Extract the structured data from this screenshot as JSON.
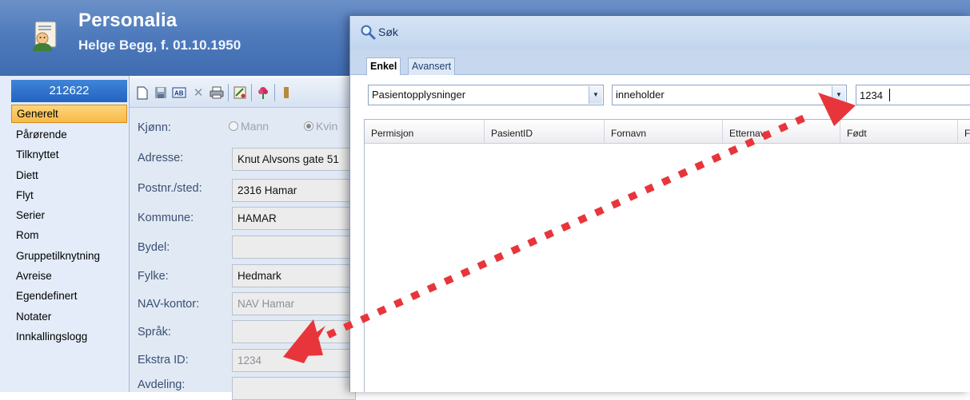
{
  "app": {
    "title": "Personalia",
    "patient_line": "Helge Begg, f. 01.10.1950",
    "patient_id": "212622",
    "nav_items": [
      {
        "label": "Generelt",
        "selected": true
      },
      {
        "label": "Pårørende"
      },
      {
        "label": "Tilknyttet"
      },
      {
        "label": "Diett"
      },
      {
        "label": "Flyt"
      },
      {
        "label": "Serier"
      },
      {
        "label": "Rom"
      },
      {
        "label": "Gruppetilknytning"
      },
      {
        "label": "Avreise"
      },
      {
        "label": "Egendefinert"
      },
      {
        "label": "Notater"
      },
      {
        "label": "Innkallingslogg"
      }
    ],
    "form": {
      "gender": {
        "label": "Kjønn:",
        "option_male": "Mann",
        "option_female": "Kvin",
        "selected": "Kvin"
      },
      "address": {
        "label": "Adresse:",
        "value": "Knut Alvsons gate 51"
      },
      "postal": {
        "label": "Postnr./sted:",
        "value": "2316 Hamar"
      },
      "municipality": {
        "label": "Kommune:",
        "value": "HAMAR"
      },
      "district": {
        "label": "Bydel:",
        "value": ""
      },
      "county": {
        "label": "Fylke:",
        "value": "Hedmark"
      },
      "nav_office": {
        "label": "NAV-kontor:",
        "value": "NAV Hamar"
      },
      "language": {
        "label": "Språk:",
        "value": ""
      },
      "extra_id": {
        "label": "Ekstra ID:",
        "value": "1234"
      },
      "department": {
        "label": "Avdeling:",
        "value": ""
      }
    },
    "toolbar_icons": [
      "new-document-icon",
      "save-icon",
      "rename-icon",
      "delete-icon",
      "print-icon",
      "tools-icon",
      "flower-icon",
      "more-icon"
    ]
  },
  "dialog": {
    "title": "Søk",
    "tabs": [
      {
        "label": "Enkel",
        "active": true
      },
      {
        "label": "Avansert",
        "active": false
      }
    ],
    "field_select": "Pasientopplysninger",
    "operator_select": "inneholder",
    "search_value": "1234",
    "columns": [
      "Permisjon",
      "PasientID",
      "Fornavn",
      "Etternavn",
      "Født",
      "F"
    ]
  },
  "colors": {
    "banner": "#4f7bbd",
    "selected_nav": "#f7b948",
    "patient_id_bg": "#2363c0",
    "arrow": "#e8353b"
  }
}
